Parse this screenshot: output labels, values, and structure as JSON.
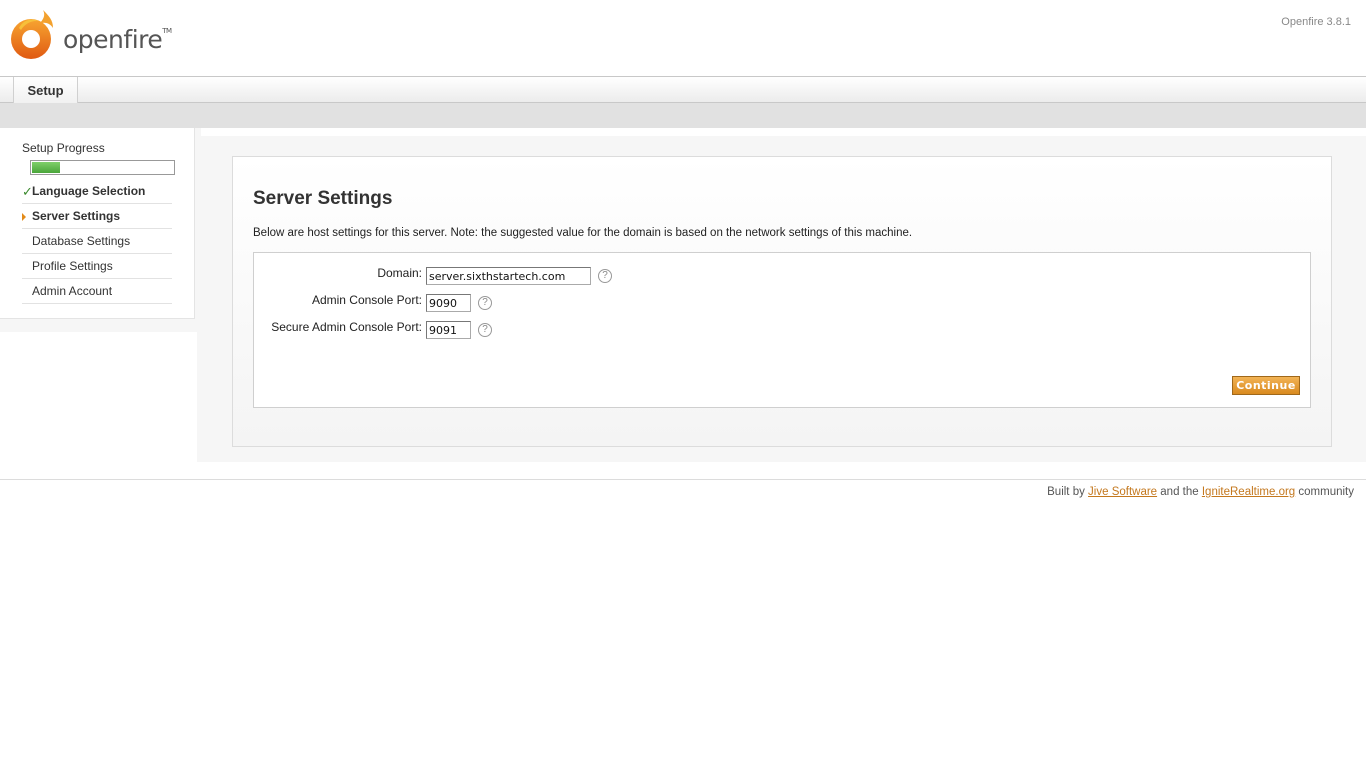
{
  "header": {
    "logo_text": "openfire",
    "logo_tm": "TM",
    "version": "Openfire 3.8.1"
  },
  "tabs": [
    {
      "label": "Setup",
      "active": true
    }
  ],
  "sidebar": {
    "progress_title": "Setup Progress",
    "progress_fraction": 0.2,
    "steps": [
      {
        "label": "Language Selection",
        "state": "done"
      },
      {
        "label": "Server Settings",
        "state": "active"
      },
      {
        "label": "Database Settings",
        "state": "pending"
      },
      {
        "label": "Profile Settings",
        "state": "pending"
      },
      {
        "label": "Admin Account",
        "state": "pending"
      }
    ]
  },
  "main": {
    "title": "Server Settings",
    "intro": "Below are host settings for this server. Note: the suggested value for the domain is based on the network settings of this machine.",
    "fields": {
      "domain": {
        "label": "Domain:",
        "value": "server.sixthstartech.com"
      },
      "admin_port": {
        "label": "Admin Console Port:",
        "value": "9090"
      },
      "secure_admin_port": {
        "label": "Secure Admin Console Port:",
        "value": "9091"
      }
    },
    "help_glyph": "?",
    "continue_label": "Continue"
  },
  "footer": {
    "prefix": "Built by",
    "jive_link": "Jive Software",
    "middle": "and the",
    "ignite_link": "IgniteRealtime.org",
    "suffix": "community"
  },
  "colors": {
    "accent_orange": "#d98a1f",
    "link": "#c4781e",
    "progress_green": "#4aa53a"
  },
  "icons": {
    "logo": "openfire-flame-icon",
    "done": "checkmark-icon",
    "active": "triangle-right-icon",
    "help": "help-circle-icon"
  }
}
